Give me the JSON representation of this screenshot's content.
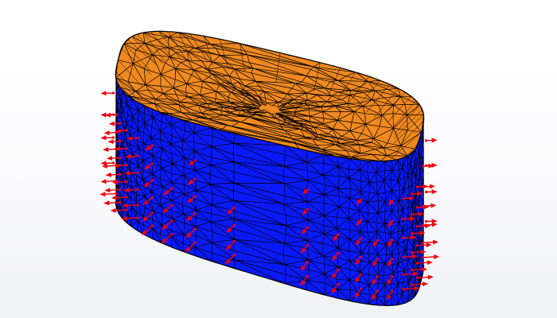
{
  "viewport": {
    "background_top": "#ffffff",
    "background_bottom": "#f0f1f5"
  },
  "model": {
    "shape": "open-top-obround-tank",
    "outer_surface_color": "#0a1aff",
    "inner_surface_color": "#f0891f",
    "mesh_line_color": "#000000",
    "mesh_element_type": "triangle"
  },
  "load_arrows": {
    "icon": "force-arrow",
    "color": "#f0000a"
  }
}
